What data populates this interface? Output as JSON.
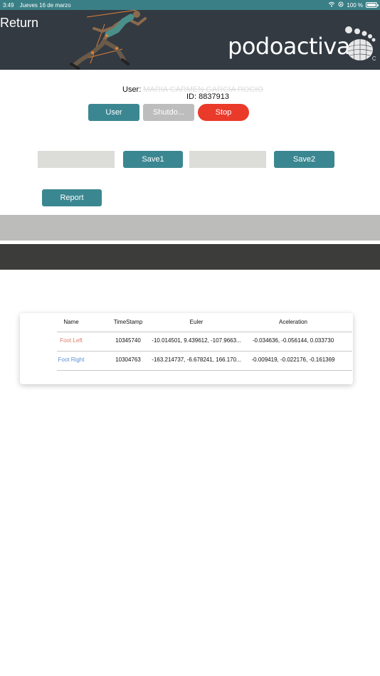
{
  "status_bar": {
    "time": "3:49",
    "date": "Jueves 16 de marzo",
    "battery": "100 %",
    "battery_level": 1.0
  },
  "header": {
    "return_label": "Return",
    "brand": "podoactiva"
  },
  "session": {
    "user_label": "User:",
    "user_name": "MARIA CARMEN GARCIA ROCIO",
    "id_label": "ID:",
    "id_value": "8837913"
  },
  "buttons": {
    "user": "User",
    "shutdown": "Shutdo...",
    "stop": "Stop",
    "save1": "Save1",
    "save2": "Save2",
    "report": "Report"
  },
  "fields": {
    "field1_value": "",
    "field2_value": ""
  },
  "table": {
    "headers": [
      "Name",
      "TimeStamp",
      "Euler",
      "Aceleration"
    ],
    "rows": [
      {
        "name": "Foot Left",
        "timestamp": "10345740",
        "euler": "-10.014501, 9.439612, -107.9663...",
        "acceleration": "-0.034636, -0.056144, 0.033730"
      },
      {
        "name": "Foot Right",
        "timestamp": "10304763",
        "euler": "-163.214737, -6.678241, 166.170...",
        "acceleration": "-0.009419, -0.022176, -0.161369"
      }
    ]
  },
  "colors": {
    "teal": "#3b8791",
    "stop_red": "#ea3a2a",
    "header_bg": "#333a42",
    "foot_left": "#e07a6a",
    "foot_right": "#5b8fd6"
  }
}
